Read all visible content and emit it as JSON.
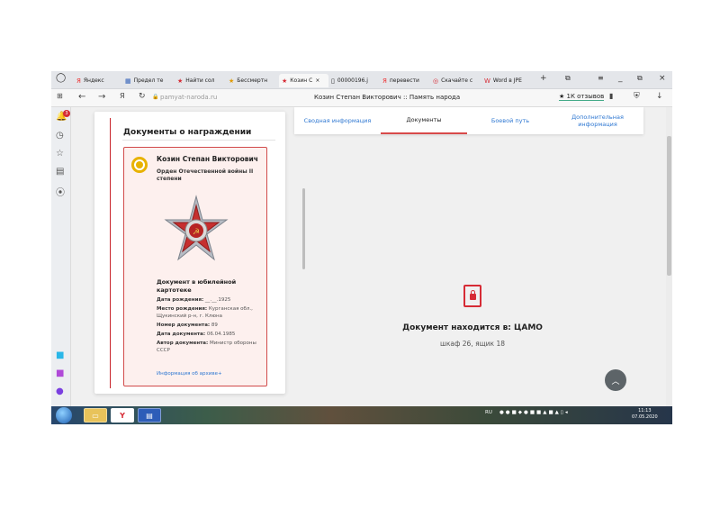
{
  "browser": {
    "tabs": [
      {
        "label": "Яндекс",
        "icon": "yandex-icon",
        "glyph": "Я"
      },
      {
        "label": "Предел те",
        "icon": "page-icon",
        "glyph": "▦"
      },
      {
        "label": "Найти сол",
        "icon": "star-icon",
        "glyph": "★"
      },
      {
        "label": "Бессмертн",
        "icon": "star-icon",
        "glyph": "★"
      },
      {
        "label": "Козин С",
        "icon": "star-icon",
        "glyph": "★",
        "active": true
      },
      {
        "label": "00000196.j",
        "icon": "file-icon",
        "glyph": "▯"
      },
      {
        "label": "перевести",
        "icon": "yandex-icon",
        "glyph": "Я"
      },
      {
        "label": "Скачайте с",
        "icon": "opera-icon",
        "glyph": "◎"
      },
      {
        "label": "Word в JPE",
        "icon": "word-icon",
        "glyph": "W"
      }
    ],
    "new_tab": "+",
    "url": "pamyat-naroda.ru",
    "page_title": "Козин Степан Викторович :: Память народа",
    "reviews": "★ 1К отзывов",
    "notification_count": "3"
  },
  "award_card": {
    "heading": "Документы о награждении",
    "person_name": "Козин Степан Викторович",
    "order_name": "Орден Отечественной войны II степени",
    "doc_title": "Документ в юбилейной картотеке",
    "fields": [
      {
        "label": "Дата рождения:",
        "value": "__.__.1925"
      },
      {
        "label": "Место рождения:",
        "value": "Курганская обл., Щукинский р-н, г. Клюна"
      },
      {
        "label": "Номер документа:",
        "value": "89"
      },
      {
        "label": "Дата документа:",
        "value": "06.04.1985"
      },
      {
        "label": "Автор документа:",
        "value": "Министр обороны СССР"
      }
    ],
    "archive_link": "Информация об архиве+"
  },
  "page_tabs": [
    {
      "label": "Сводная информация"
    },
    {
      "label": "Документы",
      "active": true
    },
    {
      "label": "Боевой путь"
    },
    {
      "label": "Дополнительная информация"
    }
  ],
  "location": {
    "title": "Документ находится в: ЦАМО",
    "subtitle": "шкаф 26, ящик 18"
  },
  "taskbar": {
    "lang": "RU",
    "time": "11:13",
    "date": "07.05.2020"
  },
  "colors": {
    "accent_red": "#d62b35",
    "link_blue": "#2f78d2",
    "medal_gold": "#e8b200"
  }
}
